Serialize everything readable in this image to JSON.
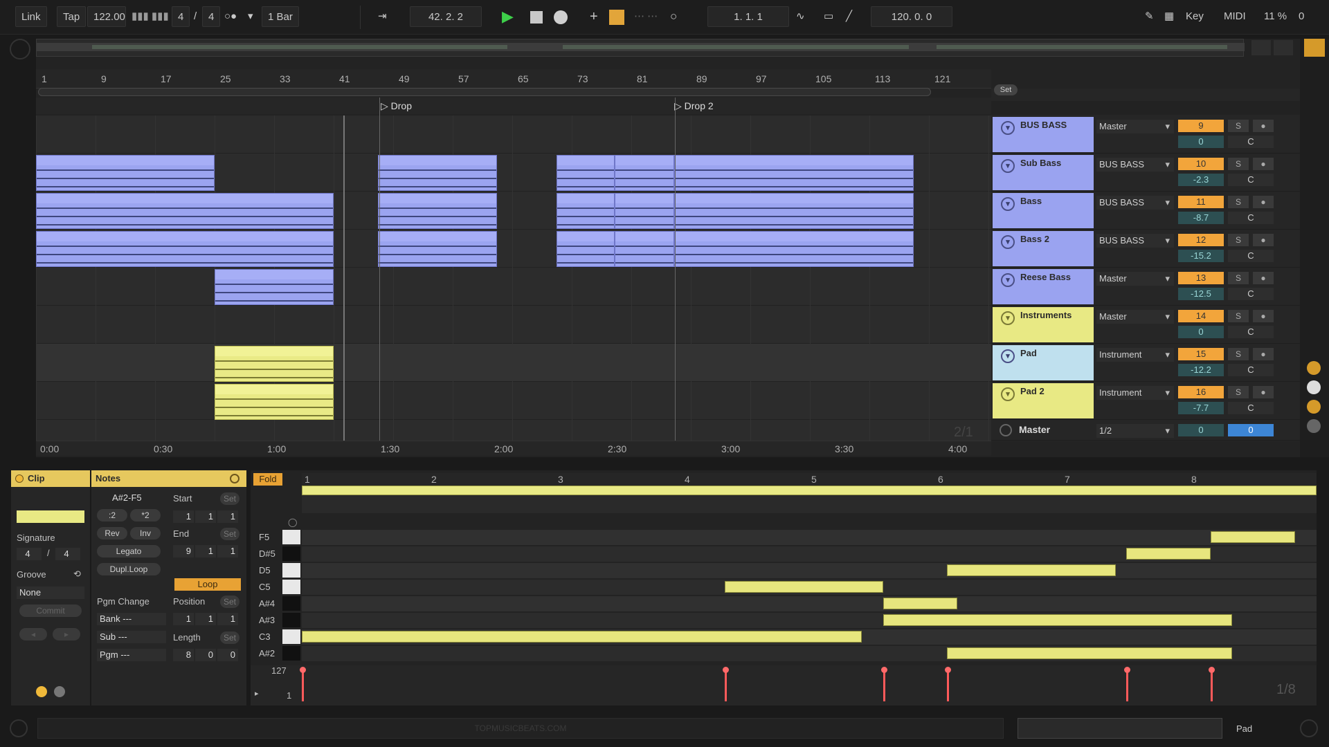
{
  "transport": {
    "link": "Link",
    "tap": "Tap",
    "tempo": "122.00",
    "signature_num": "4",
    "signature_den": "4",
    "quantize": "1 Bar",
    "position": "42.  2.  2",
    "loop_start": "1.  1.  1",
    "loop_length": "120.  0.  0",
    "key": "Key",
    "midi": "MIDI",
    "cpu": "11 %",
    "hd": "0"
  },
  "ruler": {
    "bars": [
      "1",
      "9",
      "17",
      "25",
      "33",
      "41",
      "49",
      "57",
      "65",
      "73",
      "81",
      "89",
      "97",
      "105",
      "113",
      "121"
    ],
    "times": [
      "0:00",
      "0:30",
      "1:00",
      "1:30",
      "2:00",
      "2:30",
      "3:00",
      "3:30",
      "4:00"
    ]
  },
  "locators": [
    "Drop",
    "Drop 2"
  ],
  "set_label": "Set",
  "zoom_label": "2/1",
  "tracks": [
    {
      "name": "BUS BASS",
      "route": "Master",
      "num": "9",
      "vol": "0",
      "pan": "C",
      "color": "#9aa3f0"
    },
    {
      "name": "Sub Bass",
      "route": "BUS BASS",
      "num": "10",
      "vol": "-2.3",
      "pan": "C",
      "color": "#9aa3f0"
    },
    {
      "name": "Bass",
      "route": "BUS BASS",
      "num": "11",
      "vol": "-8.7",
      "pan": "C",
      "color": "#9aa3f0"
    },
    {
      "name": "Bass 2",
      "route": "BUS BASS",
      "num": "12",
      "vol": "-15.2",
      "pan": "C",
      "color": "#9aa3f0"
    },
    {
      "name": "Reese Bass",
      "route": "Master",
      "num": "13",
      "vol": "-12.5",
      "pan": "C",
      "color": "#9aa3f0"
    },
    {
      "name": "Instruments",
      "route": "Master",
      "num": "14",
      "vol": "0",
      "pan": "C",
      "color": "#e8e984"
    },
    {
      "name": "Pad",
      "route": "Instrument",
      "num": "15",
      "vol": "-12.2",
      "pan": "C",
      "color": "#bfe0ee"
    },
    {
      "name": "Pad 2",
      "route": "Instrument",
      "num": "16",
      "vol": "-7.7",
      "pan": "C",
      "color": "#e8e984"
    }
  ],
  "master": {
    "name": "Master",
    "route": "1/2",
    "num": "0",
    "vol": "0"
  },
  "clip_panel": {
    "title": "Clip",
    "signature_label": "Signature",
    "sig_num": "4",
    "sig_slash": "/",
    "sig_den": "4",
    "groove_label": "Groove",
    "groove_value": "None",
    "commit": "Commit"
  },
  "notes_panel": {
    "title": "Notes",
    "range": "A#2-F5",
    "div2": ":2",
    "mul2": "*2",
    "rev": "Rev",
    "inv": "Inv",
    "legato": "Legato",
    "dupl_loop": "Dupl.Loop",
    "start_label": "Start",
    "start_val": [
      "1",
      "1",
      "1"
    ],
    "end_label": "End",
    "end_val": [
      "9",
      "1",
      "1"
    ],
    "loop": "Loop",
    "pgm_change": "Pgm Change",
    "bank": "Bank ---",
    "sub": "Sub ---",
    "pgm": "Pgm ---",
    "position_label": "Position",
    "position_val": [
      "1",
      "1",
      "1"
    ],
    "length_label": "Length",
    "length_val": [
      "8",
      "0",
      "0"
    ],
    "set": "Set"
  },
  "piano_roll": {
    "fold": "Fold",
    "bars": [
      "1",
      "2",
      "3",
      "4",
      "5",
      "6",
      "7",
      "8"
    ],
    "keys": [
      "F5",
      "D#5",
      "D5",
      "C5",
      "A#4",
      "A#3",
      "C3",
      "A#2"
    ],
    "vel_max": "127",
    "vel_min": "1",
    "grid": "1/8"
  },
  "footer": {
    "watermark": "TOPMUSICBEATS.COM",
    "track_name": "Pad"
  }
}
